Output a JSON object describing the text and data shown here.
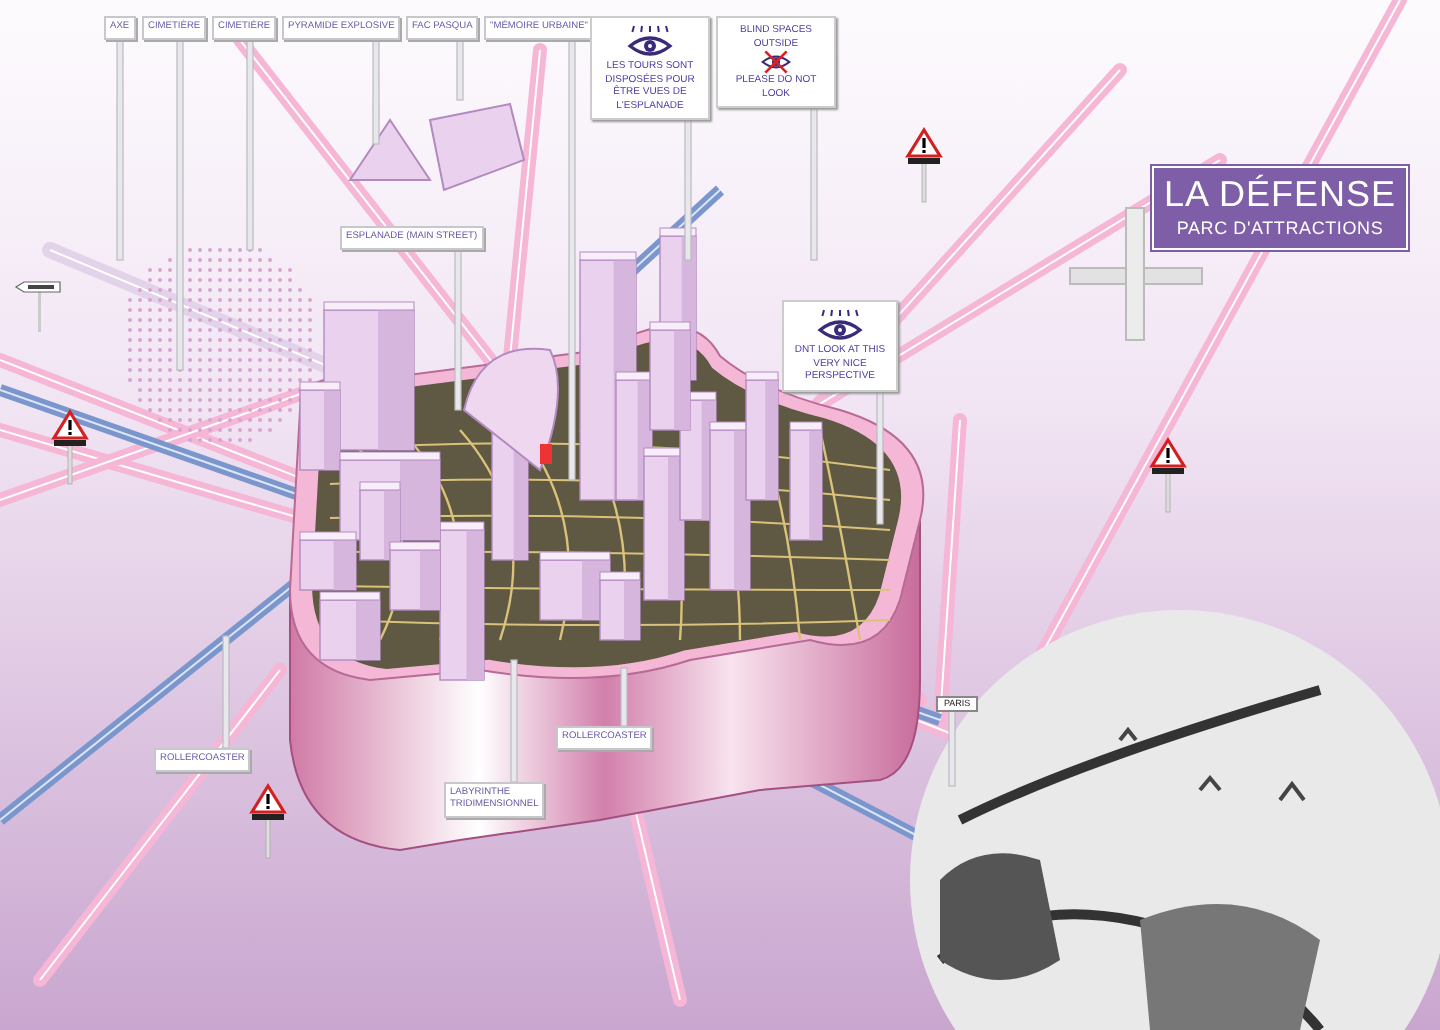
{
  "title": {
    "heading": "LA DÉFENSE",
    "subheading": "PARC D'ATTRACTIONS"
  },
  "labels": [
    {
      "text": "AXE"
    },
    {
      "text": "CIMETIÈRE"
    },
    {
      "text": "CIMETIÈRE"
    },
    {
      "text": "PYRAMIDE EXPLOSIVE"
    },
    {
      "text": "FAC PASQUA"
    },
    {
      "text": "\"MÉMOIRE URBAINE\""
    },
    {
      "text": "ESPLANADE (MAIN STREET)"
    },
    {
      "text": "ROLLERCOASTER"
    },
    {
      "text": "ROLLERCOASTER"
    },
    {
      "text": "LABYRINTHE TRIDIMENSIONNEL"
    }
  ],
  "signs": [
    {
      "kind": "eye",
      "text": "LES TOURS SONT DISPOSÉES POUR ÊTRE VUES DE L'ESPLANADE"
    },
    {
      "kind": "crossed-eye",
      "text": "BLIND SPACES OUTSIDE",
      "text_bottom": "PLEASE DO NOT LOOK"
    },
    {
      "kind": "eye",
      "text": "DNT LOOK AT THIS VERY NICE PERSPECTIVE"
    }
  ],
  "road_signs": [
    {
      "text": "PARIS"
    }
  ]
}
